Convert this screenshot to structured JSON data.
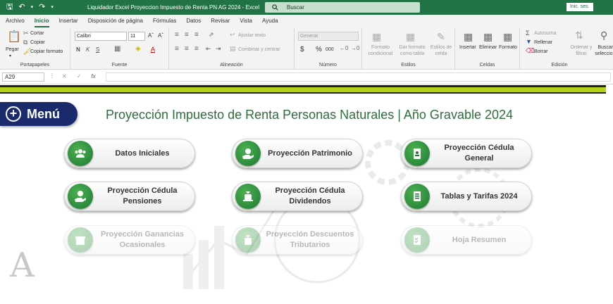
{
  "window": {
    "title": "Liquidador Excel Proyeccion Impuesto de Renta PN AG 2024  -  Excel",
    "search_label": "Buscar",
    "signin_label": "Inic. ses."
  },
  "tabs": [
    "Archivo",
    "Inicio",
    "Insertar",
    "Disposición de página",
    "Fórmulas",
    "Datos",
    "Revisar",
    "Vista",
    "Ayuda"
  ],
  "active_tab": "Inicio",
  "ribbon": {
    "clipboard": {
      "paste": "Pegar",
      "cut": "Cortar",
      "copy": "Copiar",
      "format_painter": "Copiar formato",
      "label": "Portapapeles"
    },
    "font": {
      "name": "Calibri",
      "size": "11",
      "label": "Fuente",
      "bold": "N",
      "italic": "K",
      "underline": "S"
    },
    "alignment": {
      "wrap": "Ajustar texto",
      "merge": "Combinar y centrar",
      "label": "Alineación"
    },
    "number": {
      "format": "General",
      "currency": "$",
      "percent": "%",
      "thousands": "000",
      "label": "Número"
    },
    "styles": {
      "conditional": "Formato condicional",
      "table": "Dar formato como tabla",
      "cell_styles": "Estilos de celda",
      "label": "Estilos"
    },
    "cells": {
      "insert": "Insertar",
      "delete": "Eliminar",
      "format": "Formato",
      "label": "Celdas"
    },
    "editing": {
      "autosum": "Autosuma",
      "fill": "Rellenar",
      "clear": "Borrar",
      "sort": "Ordenar y filtrar",
      "find": "Buscar y seleccionar",
      "label": "Edición"
    }
  },
  "formula_bar": {
    "cell_ref": "A29",
    "fx": "fx",
    "content": ""
  },
  "sheet": {
    "menu_label": "Menú",
    "title": "Proyección Impuesto de Renta Personas Naturales | Año Gravable 2024",
    "cards": [
      {
        "label": "Datos Iniciales",
        "icon": "users-icon",
        "enabled": true
      },
      {
        "label": "Proyección Patrimonio",
        "icon": "hand-money-icon",
        "enabled": true
      },
      {
        "label": "Proyección Cédula General",
        "icon": "id-badge-icon",
        "enabled": true
      },
      {
        "label": "Proyección Cédula Pensiones",
        "icon": "hand-coin-icon",
        "enabled": true
      },
      {
        "label": "Proyección Cédula Dividendos",
        "icon": "money-bag-icon",
        "enabled": true
      },
      {
        "label": "Tablas y Tarifas 2024",
        "icon": "document-icon",
        "enabled": true
      },
      {
        "label": "Proyección Ganancias Ocasionales",
        "icon": "gift-box-icon",
        "enabled": false
      },
      {
        "label": "Proyección Descuentos Tributarios",
        "icon": "discount-bag-icon",
        "enabled": false
      },
      {
        "label": "Hoja Resumen",
        "icon": "checklist-icon",
        "enabled": false
      }
    ]
  },
  "colors": {
    "excel_green": "#217346",
    "menu_navy": "#1a2a6c",
    "title_green": "#2d6e3c",
    "lime": "#b5d31b",
    "icon_green": "#2e8b3e"
  }
}
